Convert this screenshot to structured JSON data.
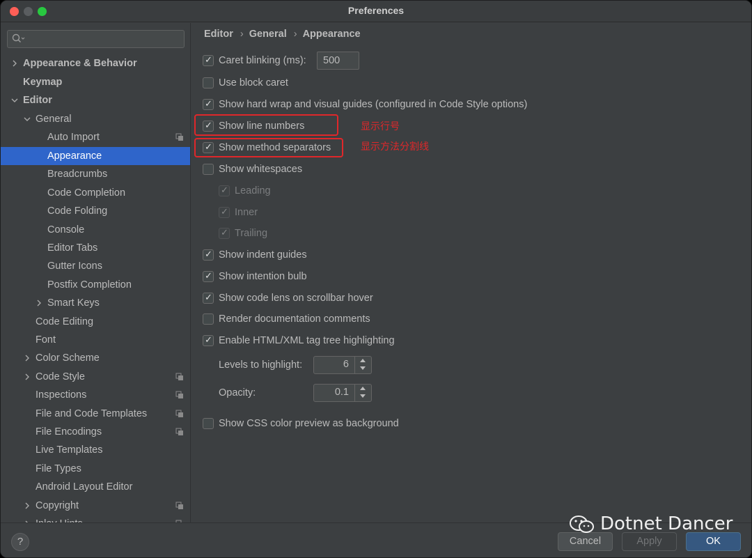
{
  "window": {
    "title": "Preferences"
  },
  "search": {
    "placeholder": ""
  },
  "sidebar": {
    "items": [
      {
        "label": "Appearance & Behavior"
      },
      {
        "label": "Keymap"
      },
      {
        "label": "Editor"
      },
      {
        "label": "General"
      },
      {
        "label": "Auto Import"
      },
      {
        "label": "Appearance"
      },
      {
        "label": "Breadcrumbs"
      },
      {
        "label": "Code Completion"
      },
      {
        "label": "Code Folding"
      },
      {
        "label": "Console"
      },
      {
        "label": "Editor Tabs"
      },
      {
        "label": "Gutter Icons"
      },
      {
        "label": "Postfix Completion"
      },
      {
        "label": "Smart Keys"
      },
      {
        "label": "Code Editing"
      },
      {
        "label": "Font"
      },
      {
        "label": "Color Scheme"
      },
      {
        "label": "Code Style"
      },
      {
        "label": "Inspections"
      },
      {
        "label": "File and Code Templates"
      },
      {
        "label": "File Encodings"
      },
      {
        "label": "Live Templates"
      },
      {
        "label": "File Types"
      },
      {
        "label": "Android Layout Editor"
      },
      {
        "label": "Copyright"
      },
      {
        "label": "Inlay Hints"
      }
    ]
  },
  "breadcrumb": [
    "Editor",
    "General",
    "Appearance"
  ],
  "settings": {
    "caret_blinking": {
      "label": "Caret blinking (ms):",
      "value": "500",
      "checked": true
    },
    "block_caret": {
      "label": "Use block caret",
      "checked": false
    },
    "hard_wrap": {
      "label": "Show hard wrap and visual guides (configured in Code Style options)",
      "checked": true
    },
    "line_numbers": {
      "label": "Show line numbers",
      "checked": true
    },
    "method_separators": {
      "label": "Show method separators",
      "checked": true
    },
    "whitespaces": {
      "label": "Show whitespaces",
      "checked": false
    },
    "leading": {
      "label": "Leading",
      "checked": true
    },
    "inner": {
      "label": "Inner",
      "checked": true
    },
    "trailing": {
      "label": "Trailing",
      "checked": true
    },
    "indent_guides": {
      "label": "Show indent guides",
      "checked": true
    },
    "intention_bulb": {
      "label": "Show intention bulb",
      "checked": true
    },
    "code_lens": {
      "label": "Show code lens on scrollbar hover",
      "checked": true
    },
    "render_docs": {
      "label": "Render documentation comments",
      "checked": false
    },
    "tag_tree": {
      "label": "Enable HTML/XML tag tree highlighting",
      "checked": true
    },
    "levels": {
      "label": "Levels to highlight:",
      "value": "6"
    },
    "opacity": {
      "label": "Opacity:",
      "value": "0.1"
    },
    "css_preview": {
      "label": "Show CSS color preview as background",
      "checked": false
    }
  },
  "annotations": {
    "line_numbers": "显示行号",
    "method_separators": "显示方法分割线"
  },
  "footer": {
    "help": "?",
    "cancel": "Cancel",
    "apply": "Apply",
    "ok": "OK"
  },
  "watermark": "Dotnet Dancer",
  "colors": {
    "selection": "#2f65ca",
    "annotation_red": "#e0272a",
    "ok_button": "#365880"
  }
}
